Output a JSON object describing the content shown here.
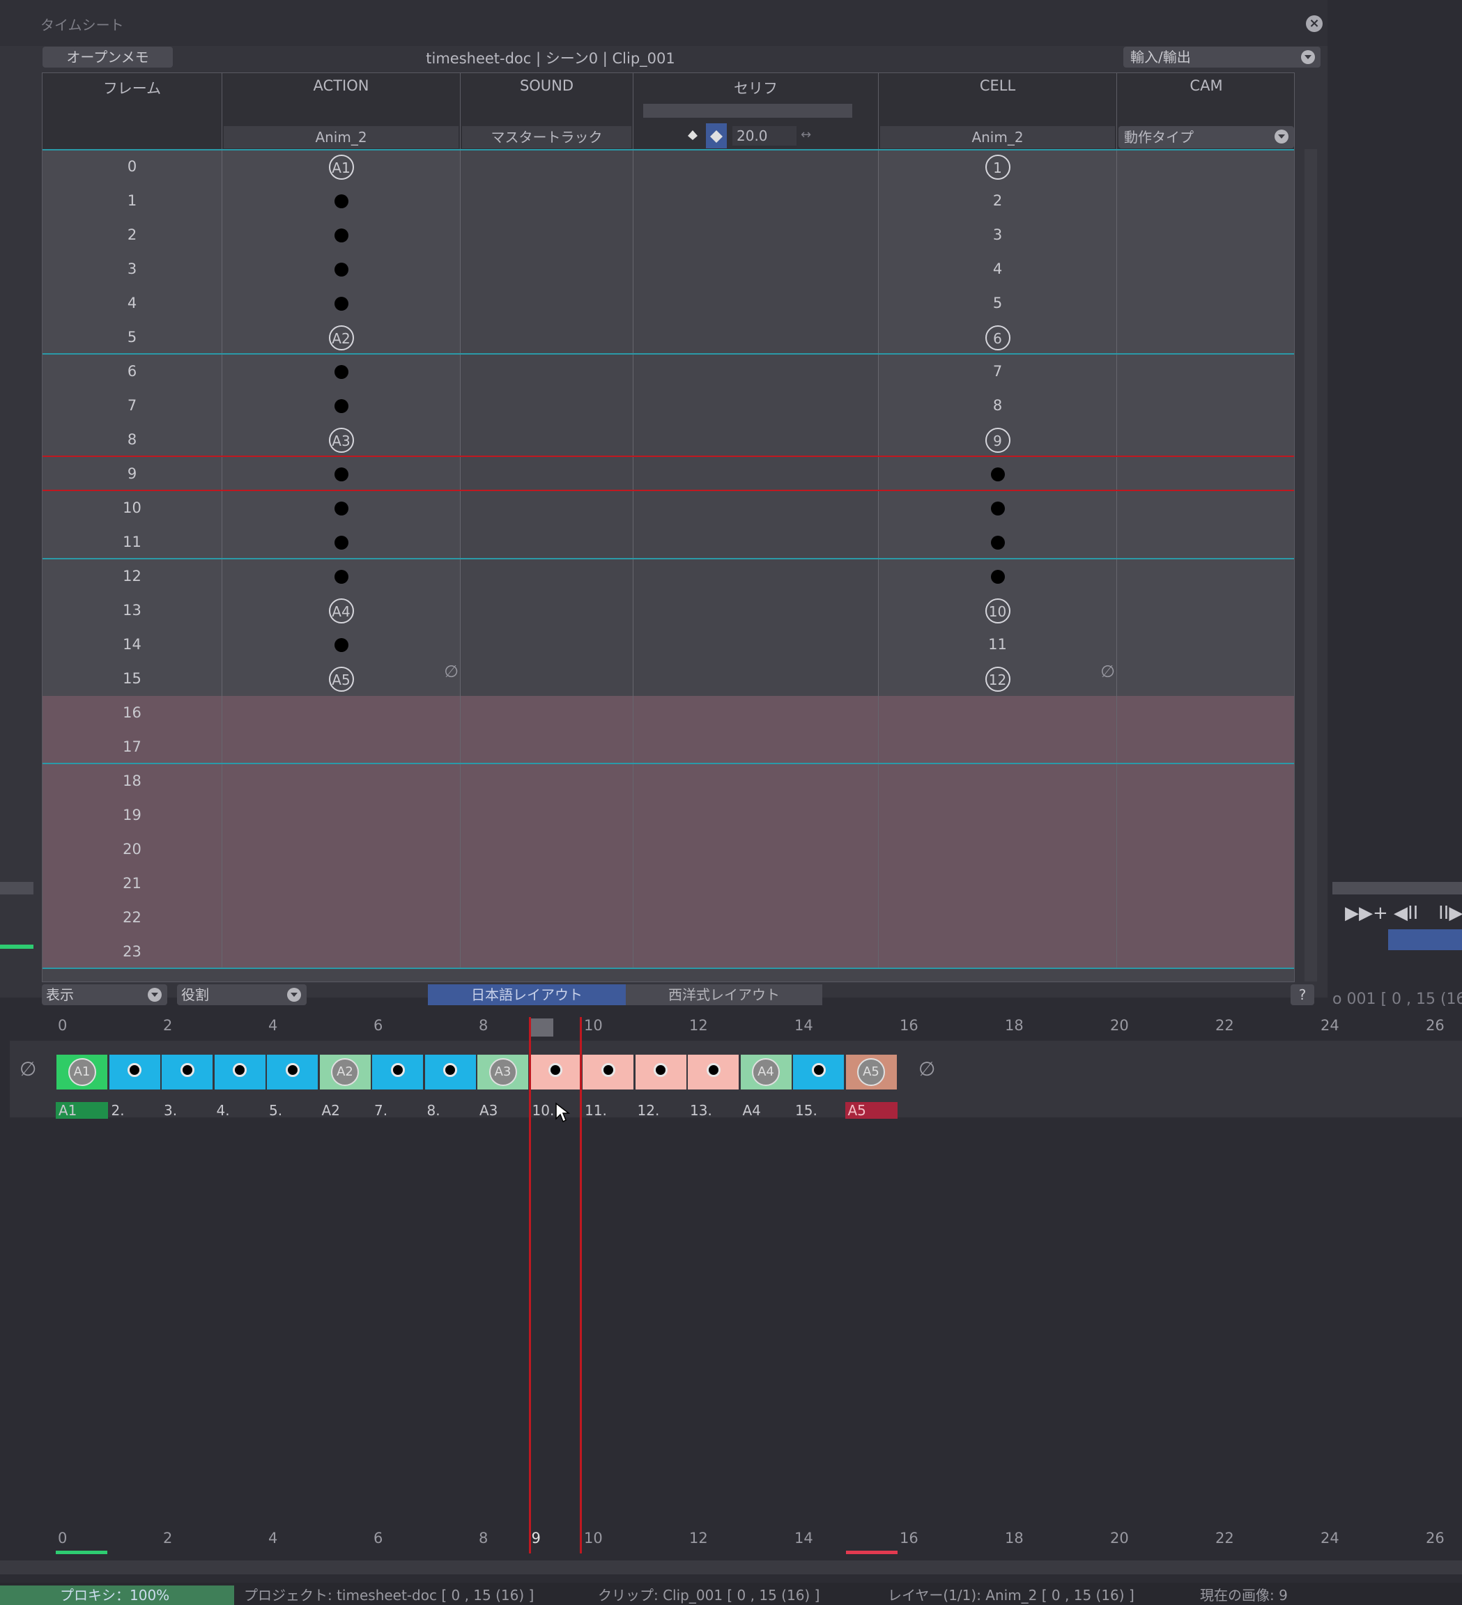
{
  "panel": {
    "title": "タイムシート",
    "memo_button": "オープンメモ",
    "doc_title": "timesheet-doc | シーン0 | Clip_001",
    "io_dropdown": "輸入/輸出"
  },
  "columns": {
    "frame": "フレーム",
    "action": "ACTION",
    "action_layer": "Anim_2",
    "sound": "SOUND",
    "sound_track": "マスタートラック",
    "serif": "セリフ",
    "serif_value": "20.0",
    "cell": "CELL",
    "cell_layer": "Anim_2",
    "cam": "CAM",
    "cam_dropdown": "動作タイプ"
  },
  "rows": [
    {
      "frame": "0",
      "action": "A1",
      "action_type": "key",
      "cell": "1",
      "cell_type": "key"
    },
    {
      "frame": "1",
      "action": "",
      "action_type": "dot",
      "cell": "2",
      "cell_type": "text"
    },
    {
      "frame": "2",
      "action": "",
      "action_type": "dot",
      "cell": "3",
      "cell_type": "text"
    },
    {
      "frame": "3",
      "action": "",
      "action_type": "dot",
      "cell": "4",
      "cell_type": "text"
    },
    {
      "frame": "4",
      "action": "",
      "action_type": "dot",
      "cell": "5",
      "cell_type": "text"
    },
    {
      "frame": "5",
      "action": "A2",
      "action_type": "key",
      "cell": "6",
      "cell_type": "key"
    },
    {
      "frame": "6",
      "action": "",
      "action_type": "dot",
      "cell": "7",
      "cell_type": "text"
    },
    {
      "frame": "7",
      "action": "",
      "action_type": "dot",
      "cell": "8",
      "cell_type": "text"
    },
    {
      "frame": "8",
      "action": "A3",
      "action_type": "key",
      "cell": "9",
      "cell_type": "key"
    },
    {
      "frame": "9",
      "action": "",
      "action_type": "dot",
      "cell": "",
      "cell_type": "dot"
    },
    {
      "frame": "10",
      "action": "",
      "action_type": "dot",
      "cell": "",
      "cell_type": "dot"
    },
    {
      "frame": "11",
      "action": "",
      "action_type": "dot",
      "cell": "",
      "cell_type": "dot"
    },
    {
      "frame": "12",
      "action": "",
      "action_type": "dot",
      "cell": "",
      "cell_type": "dot"
    },
    {
      "frame": "13",
      "action": "A4",
      "action_type": "key",
      "cell": "10",
      "cell_type": "key"
    },
    {
      "frame": "14",
      "action": "",
      "action_type": "dot",
      "cell": "11",
      "cell_type": "text"
    },
    {
      "frame": "15",
      "action": "A5",
      "action_type": "key",
      "cell": "12",
      "cell_type": "key"
    },
    {
      "frame": "16",
      "action": "",
      "action_type": "empty",
      "cell": "",
      "cell_type": "empty"
    },
    {
      "frame": "17",
      "action": "",
      "action_type": "empty",
      "cell": "",
      "cell_type": "empty"
    },
    {
      "frame": "18",
      "action": "",
      "action_type": "empty",
      "cell": "",
      "cell_type": "empty"
    },
    {
      "frame": "19",
      "action": "",
      "action_type": "empty",
      "cell": "",
      "cell_type": "empty"
    },
    {
      "frame": "20",
      "action": "",
      "action_type": "empty",
      "cell": "",
      "cell_type": "empty"
    },
    {
      "frame": "21",
      "action": "",
      "action_type": "empty",
      "cell": "",
      "cell_type": "empty"
    },
    {
      "frame": "22",
      "action": "",
      "action_type": "empty",
      "cell": "",
      "cell_type": "empty"
    },
    {
      "frame": "23",
      "action": "",
      "action_type": "empty",
      "cell": "",
      "cell_type": "empty"
    }
  ],
  "footer": {
    "view_dropdown": "表示",
    "role_dropdown": "役割",
    "tab_japanese": "日本語レイアウト",
    "tab_western": "西洋式レイアウト",
    "help": "?"
  },
  "peek_text": "o 001 [ 0 , 15  (16",
  "timeline": {
    "ruler_ticks": [
      "0",
      "2",
      "4",
      "6",
      "8",
      "9",
      "10",
      "12",
      "14",
      "16",
      "18",
      "20",
      "22",
      "24",
      "26"
    ],
    "frames": [
      {
        "label": "A1",
        "type": "key",
        "color": "#2fcc66"
      },
      {
        "label": "2.",
        "type": "dot",
        "color": "#1fb3e6"
      },
      {
        "label": "3.",
        "type": "dot",
        "color": "#1fb3e6"
      },
      {
        "label": "4.",
        "type": "dot",
        "color": "#1fb3e6"
      },
      {
        "label": "5.",
        "type": "dot",
        "color": "#1fb3e6"
      },
      {
        "label": "A2",
        "type": "key",
        "color": "#8fd4a8"
      },
      {
        "label": "7.",
        "type": "dot",
        "color": "#1fb3e6"
      },
      {
        "label": "8.",
        "type": "dot",
        "color": "#1fb3e6"
      },
      {
        "label": "A3",
        "type": "key",
        "color": "#8fd4a8"
      },
      {
        "label": "10.",
        "type": "dot",
        "color": "#f6b9b1"
      },
      {
        "label": "11.",
        "type": "dot",
        "color": "#f6b9b1"
      },
      {
        "label": "12.",
        "type": "dot",
        "color": "#f6b9b1"
      },
      {
        "label": "13.",
        "type": "dot",
        "color": "#f6b9b1"
      },
      {
        "label": "A4",
        "type": "key",
        "color": "#8fd4a8"
      },
      {
        "label": "15.",
        "type": "dot",
        "color": "#1fb3e6"
      },
      {
        "label": "A5",
        "type": "key",
        "color": "#cf8f7a"
      }
    ]
  },
  "status": {
    "proxy": "プロキシ：100%",
    "project": "プロジェクト: timesheet-doc [ 0 , 15  (16) ]",
    "clip": "クリップ: Clip_001 [ 0 , 15  (16) ]",
    "layer": "レイヤー(1/1): Anim_2 [ 0 , 15  (16) ]",
    "current": "現在の画像: 9"
  },
  "colors": {
    "accent": "#3e5a9a",
    "playhead": "#c01820",
    "cue_line": "#2a9aa8"
  }
}
